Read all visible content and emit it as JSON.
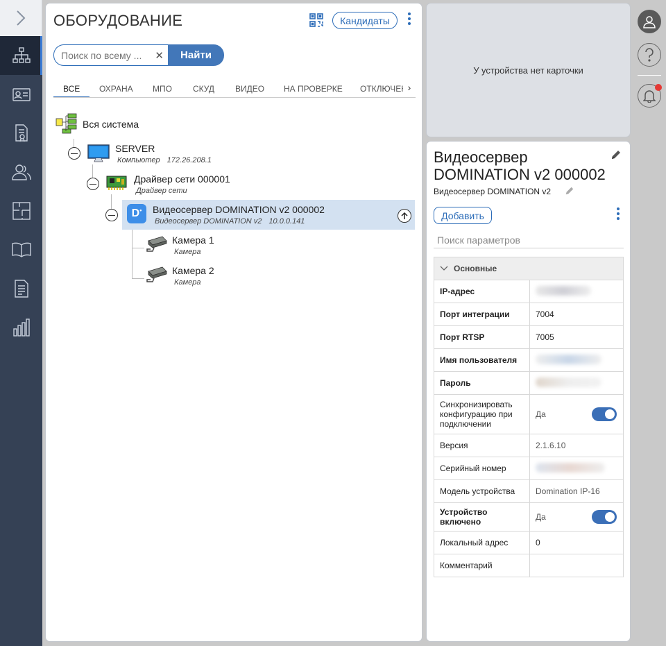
{
  "sidebar": {
    "items": [
      "hierarchy-icon",
      "id-card-icon",
      "document-certificate-icon",
      "users-icon",
      "floor-plan-icon",
      "book-icon",
      "report-icon",
      "bar-chart-icon"
    ],
    "active": "hierarchy-icon"
  },
  "tree_panel": {
    "title": "ОБОРУДОВАНИЕ",
    "candidates_label": "Кандидаты",
    "search": {
      "value": "",
      "placeholder": "Поиск по всему ...",
      "button": "Найти"
    },
    "tabs": [
      "ВСЕ",
      "ОХРАНА",
      "МПО",
      "СКУД",
      "ВИДЕО",
      "НА ПРОВЕРКЕ",
      "ОТКЛЮЧЕН"
    ],
    "active_tab": "ВСЕ",
    "nodes": [
      {
        "label": "Вся система"
      },
      {
        "label": "SERVER",
        "sub": "Компьютер",
        "sub2": "172.26.208.1"
      },
      {
        "label": "Драйвер сети 000001",
        "sub": "Драйвер сети"
      },
      {
        "label": "Видеосервер DOMINATION v2 000002",
        "sub": "Видеосервер DOMINATION v2",
        "sub2": "10.0.0.141"
      },
      {
        "label": "Камера 1",
        "sub": "Камера"
      },
      {
        "label": "Камера 2",
        "sub": "Камера"
      }
    ]
  },
  "card_panel": {
    "message": "У устройства нет карточки"
  },
  "props_panel": {
    "title": "Видеосервер DOMINATION v2 000002",
    "subtitle": "Видеосервер DOMINATION v2",
    "add_button": "Добавить",
    "search_placeholder": "Поиск параметров",
    "group": "Основные",
    "rows": [
      {
        "key": "IP-адрес",
        "value": ""
      },
      {
        "key": "Порт интеграции",
        "value": "7004"
      },
      {
        "key": "Порт RTSP",
        "value": "7005"
      },
      {
        "key": "Имя пользователя",
        "value": ""
      },
      {
        "key": "Пароль",
        "value": ""
      },
      {
        "key": "Синхронизировать конфигурацию при подключении",
        "value": "Да"
      },
      {
        "key": "Версия",
        "value": "2.1.6.10"
      },
      {
        "key": "Серийный номер",
        "value": ""
      },
      {
        "key": "Модель устройства",
        "value": "Domination IP-16"
      },
      {
        "key": "Устройство включено",
        "value": "Да"
      },
      {
        "key": "Локальный адрес",
        "value": "0"
      },
      {
        "key": "Комментарий",
        "value": ""
      }
    ]
  },
  "right_strip": {
    "items": [
      "user-icon",
      "help-icon",
      "notification-bell-icon"
    ]
  },
  "colors": {
    "accent": "#2c6cb8",
    "sidebar": "#354155",
    "selected": "#d3e1f1",
    "badge": "#e53935"
  }
}
